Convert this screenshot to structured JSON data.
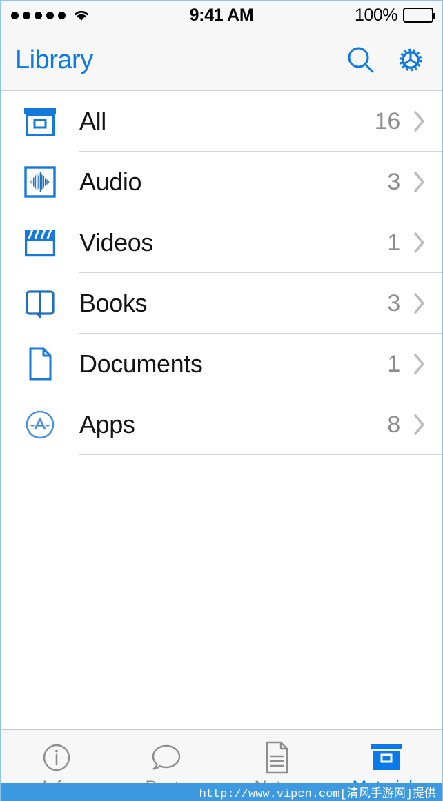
{
  "statusbar": {
    "signal_dots": 5,
    "wifi_icon": "wifi-icon",
    "time": "9:41 AM",
    "battery_percent": "100%",
    "battery_level": 100,
    "battery_color": "#4cd964"
  },
  "navbar": {
    "title": "Library",
    "search_icon": "search-icon",
    "settings_icon": "gear-icon",
    "accent_color": "#0b79e8"
  },
  "list": {
    "rows": [
      {
        "icon": "archive-box-icon",
        "label": "All",
        "count": "16"
      },
      {
        "icon": "waveform-icon",
        "label": "Audio",
        "count": "3"
      },
      {
        "icon": "clapperboard-icon",
        "label": "Videos",
        "count": "1"
      },
      {
        "icon": "open-book-icon",
        "label": "Books",
        "count": "3"
      },
      {
        "icon": "document-icon",
        "label": "Documents",
        "count": "1"
      },
      {
        "icon": "app-store-icon",
        "label": "Apps",
        "count": "8"
      }
    ],
    "chevron_icon": "chevron-right-icon",
    "count_color": "#8d8d8d",
    "separator_color": "#d3d3d3"
  },
  "tabbar": {
    "tabs": [
      {
        "icon": "info-circle-icon",
        "label": "Info",
        "active": false
      },
      {
        "icon": "speech-bubble-icon",
        "label": "Posts",
        "active": false
      },
      {
        "icon": "notes-page-icon",
        "label": "Notes",
        "active": false
      },
      {
        "icon": "archive-box-icon",
        "label": "Materials",
        "active": true
      }
    ],
    "inactive_color": "#8e8e8e",
    "active_color": "#0b79e8"
  },
  "watermark": {
    "text": "http://www.vipcn.com[清风手游网]提供",
    "background": "#3d9ae0"
  }
}
